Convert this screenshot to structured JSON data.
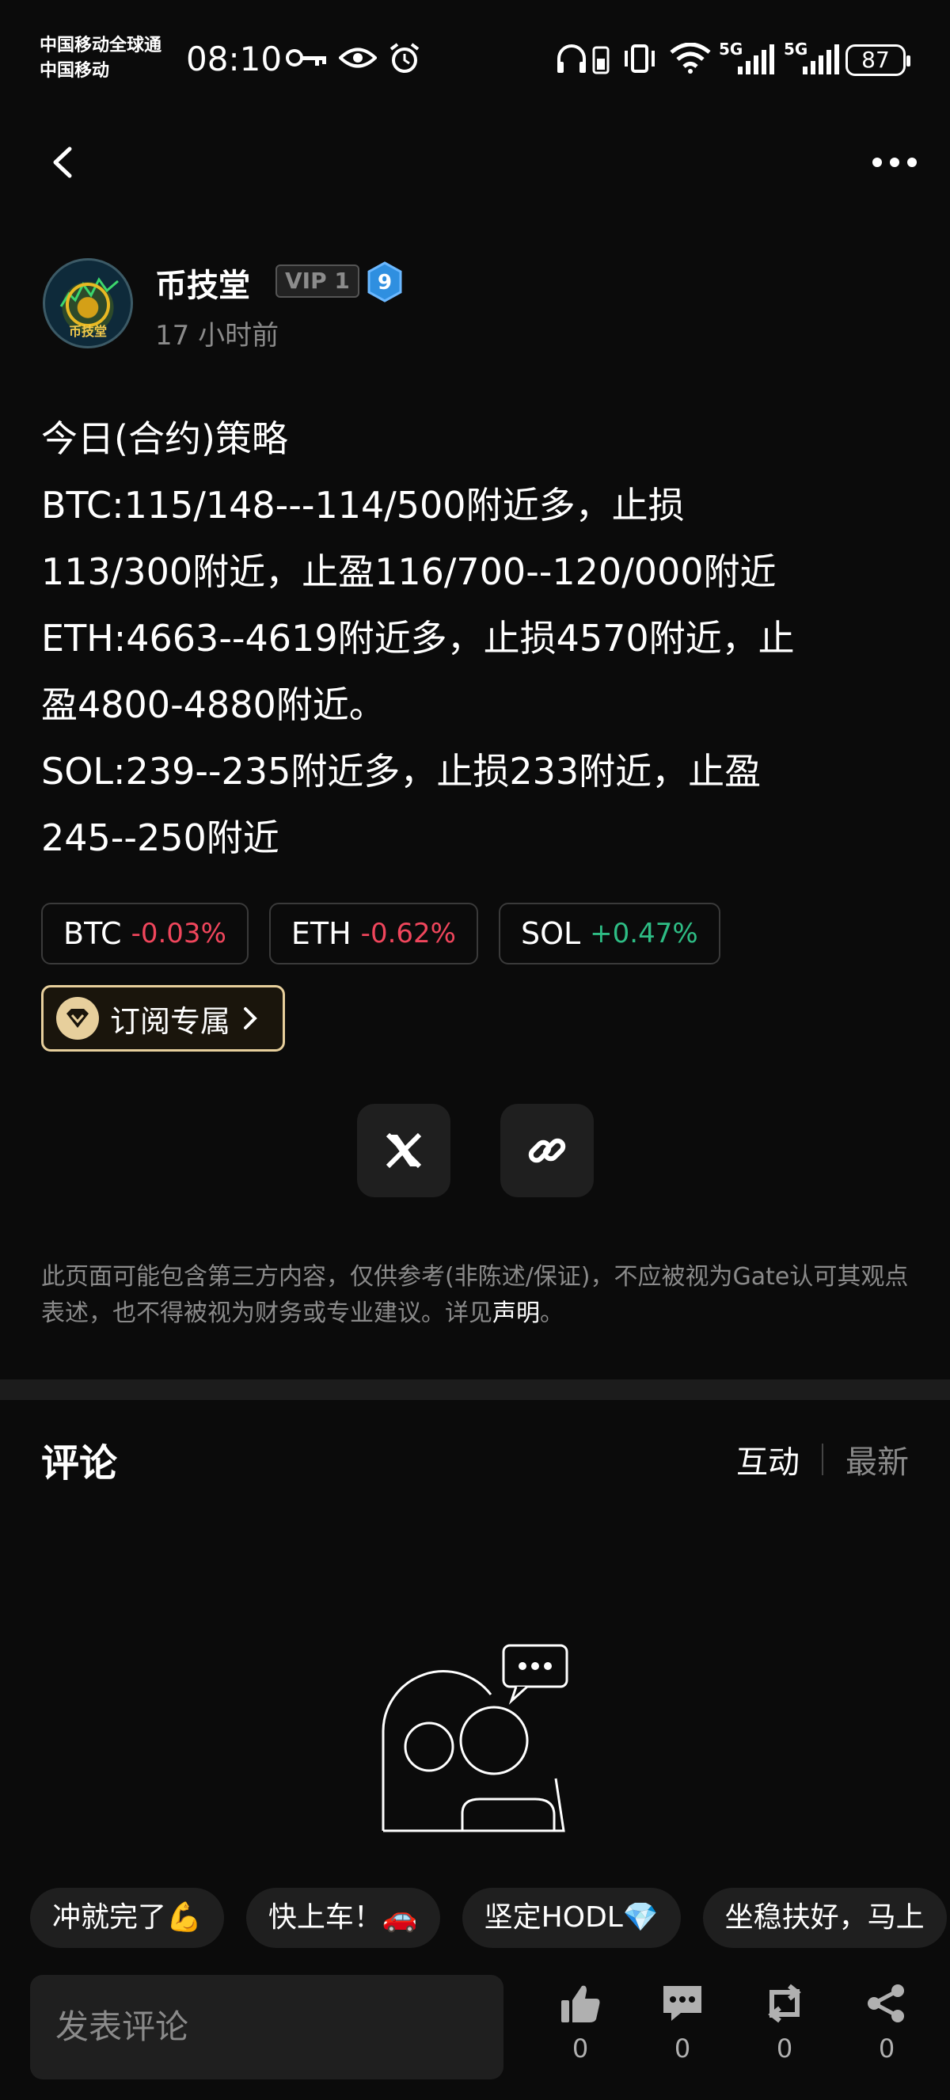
{
  "status_bar": {
    "carrier_line1": "中国移动全球通",
    "carrier_line2": "中国移动",
    "time": "08:10",
    "signal1_label": "5G",
    "signal2_label": "5G",
    "battery": "87"
  },
  "author": {
    "name": "币技堂",
    "vip": "VIP 1",
    "level": "9",
    "avatar_text": "币技堂",
    "posted": "17 小时前"
  },
  "post": {
    "lines": [
      "今日(合约)策略",
      "BTC:115/148---114/500附近多，止损",
      "113/300附近，止盈116/700--120/000附近",
      "ETH:4663--4619附近多，止损4570附近，止",
      "盈4800-4880附近。",
      "SOL:239--235附近多，止损233附近，止盈",
      "245--250附近"
    ]
  },
  "tickers": [
    {
      "symbol": "BTC",
      "change": "-0.03%",
      "direction": "down"
    },
    {
      "symbol": "ETH",
      "change": "-0.62%",
      "direction": "down"
    },
    {
      "symbol": "SOL",
      "change": "+0.47%",
      "direction": "up"
    }
  ],
  "subscribe": {
    "label": "订阅专属"
  },
  "disclaimer": {
    "text": "此页面可能包含第三方内容，仅供参考(非陈述/保证)，不应被视为Gate认可其观点表述，也不得被视为财务或专业建议。详见",
    "link": "声明",
    "suffix": "。"
  },
  "comments": {
    "title": "评论",
    "sort_active": "互动",
    "sort_other": "最新"
  },
  "quick_replies": [
    "冲就完了💪",
    "快上车！🚗",
    "坚定HODL💎",
    "坐稳扶好，马上"
  ],
  "bottom_bar": {
    "input_placeholder": "发表评论",
    "like_count": "0",
    "comment_count": "0",
    "repost_count": "0",
    "share_count": "0"
  },
  "colors": {
    "background": "#0b0b0b",
    "down": "#f0465c",
    "up": "#2ebd85",
    "subscribe_border": "#e7cf9c",
    "level_badge": "#2f8fe0"
  }
}
